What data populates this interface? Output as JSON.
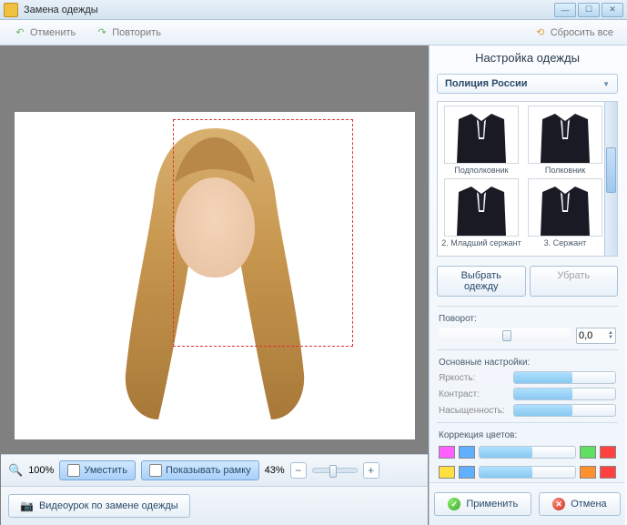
{
  "window": {
    "title": "Замена одежды"
  },
  "toolbar": {
    "undo": "Отменить",
    "redo": "Повторить",
    "reset": "Сбросить все"
  },
  "side": {
    "title": "Настройка одежды",
    "category": "Полиция России",
    "thumbs": [
      {
        "label": "Подполковник"
      },
      {
        "label": "Полковник"
      },
      {
        "label": "2. Младший сержант"
      },
      {
        "label": "3. Сержант"
      }
    ],
    "choose": "Выбрать одежду",
    "remove": "Убрать",
    "rotation_label": "Поворот:",
    "rotation_value": "0,0",
    "main_label": "Основные настройки:",
    "brightness": "Яркость:",
    "contrast": "Контраст:",
    "saturation": "Насыщенность:",
    "color_label": "Коррекция цветов:",
    "colors": [
      "#ff60ff",
      "#60b0ff",
      "#60e060",
      "#ffe040",
      "#ff9030",
      "#ff4040"
    ]
  },
  "canvas": {
    "zoom1": "100%",
    "fit": "Уместить",
    "show_frame": "Показывать рамку",
    "zoom2": "43%",
    "video": "Видеоурок по замене одежды"
  },
  "footer": {
    "apply": "Применить",
    "cancel": "Отмена"
  }
}
